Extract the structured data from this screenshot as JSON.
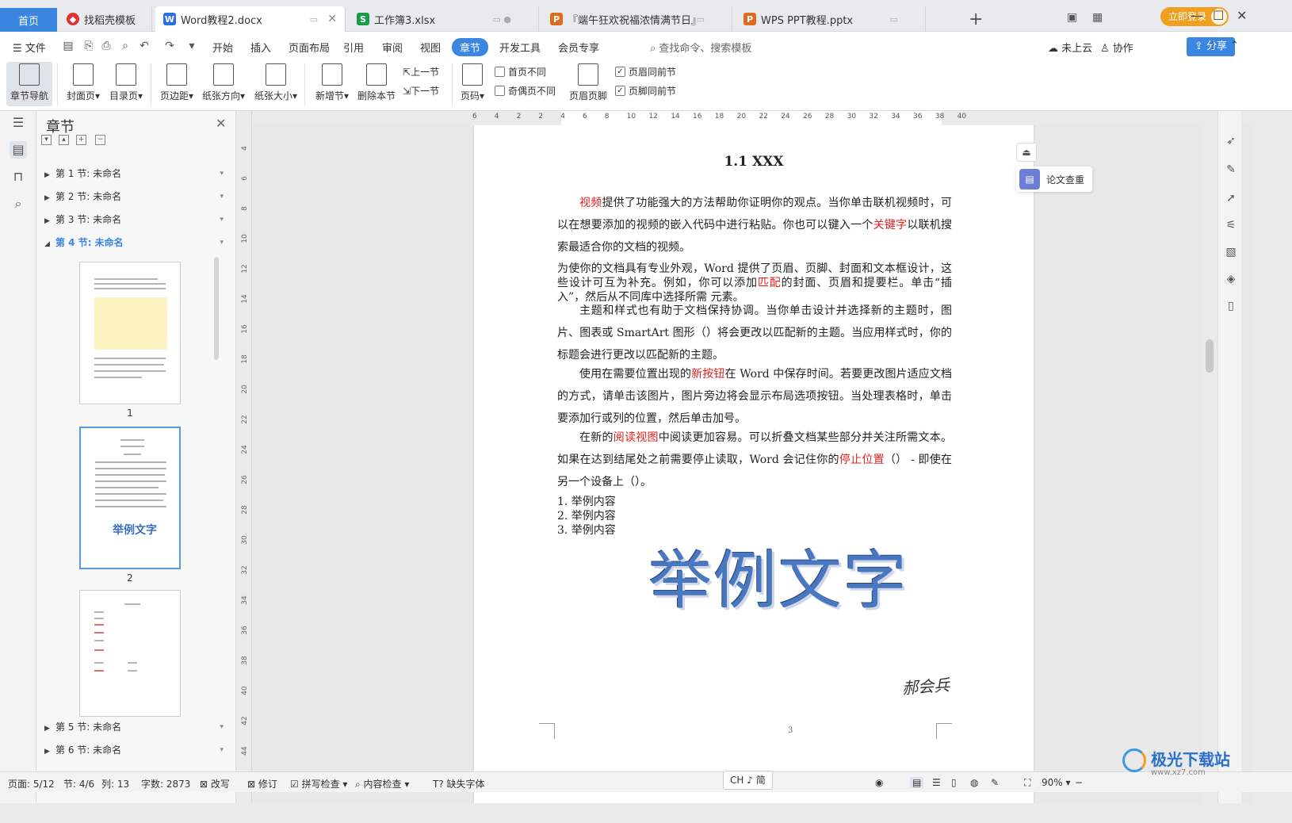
{
  "tabs": {
    "home": "首页",
    "items": [
      {
        "label": "找稻壳模板",
        "icon": "docer-icon",
        "color": "#e03030"
      },
      {
        "label": "Word教程2.docx",
        "icon": "wps-writer-icon",
        "color": "#2a70e0"
      },
      {
        "label": "工作簿3.xlsx",
        "icon": "wps-sheet-icon",
        "color": "#1a9a4a"
      },
      {
        "label": "『端午狂欢祝福浓情满节日』",
        "icon": "wps-ppt-icon",
        "color": "#e06a20"
      },
      {
        "label": "WPS PPT教程.pptx",
        "icon": "wps-ppt-icon",
        "color": "#e06a20"
      }
    ],
    "login": "立即登录"
  },
  "menu": {
    "file": "文件",
    "items": [
      "开始",
      "插入",
      "页面布局",
      "引用",
      "审阅",
      "视图",
      "章节",
      "开发工具",
      "会员专享"
    ],
    "active": "章节",
    "search": "查找命令、搜索模板",
    "cloud": "未上云",
    "collab": "协作",
    "share": "分享"
  },
  "ribbon": {
    "nav": "章节导航",
    "cover": "封面页",
    "toc": "目录页",
    "margin": "页边距",
    "orient": "纸张方向",
    "size": "纸张大小",
    "new_section": "新增节",
    "delete_section": "删除本节",
    "prev": "上一节",
    "next": "下一节",
    "page_num": "页码",
    "first_diff": "首页不同",
    "oddeven_diff": "奇偶页不同",
    "header_footer": "页眉页脚",
    "header_same": "页眉同前节",
    "footer_same": "页脚同前节"
  },
  "section_panel": {
    "title": "章节",
    "sections": [
      "第 1 节: 未命名",
      "第 2 节: 未命名",
      "第 3 节: 未命名",
      "第 4 节: 未命名",
      "第 5 节: 未命名",
      "第 6 节: 未命名"
    ],
    "thumbs": [
      "1",
      "2"
    ],
    "thumb_text": "举例文字"
  },
  "document": {
    "heading": "1.1 XXX",
    "p1": [
      {
        "t": "视频",
        "red": true
      },
      {
        "t": "提供了功能强大的方法帮助你证明你的观点。当你单击联机视频时，可以在想要添加的视频的嵌入代码中进行粘贴。你也可以键入一个"
      },
      {
        "t": "关键字",
        "red": true
      },
      {
        "t": "以联机搜索最适合你的文档的视频。"
      }
    ],
    "p2": [
      {
        "t": "为使你的文档具有专业外观，Word 提供了页眉、页脚、封面和文本框设计，这些设计可互为补充。例如，你可以添加"
      },
      {
        "t": "匹配",
        "red": true
      },
      {
        "t": "的封面、页眉和提要栏。单击“插入”，然后从不同库中选择所需 元素。"
      }
    ],
    "p3": [
      {
        "t": "主题和样式也有助于文档保持协调。当你单击设计并选择新的主题时，图片、图表或 SmartArt 图形（）将会更改以匹配新的主题。当应用样式时，你的标题会进行更改以匹配新的主题。"
      }
    ],
    "p4": [
      {
        "t": "使用在需要位置出现的"
      },
      {
        "t": "新按钮",
        "red": true
      },
      {
        "t": "在 Word 中保存时间。若要更改图片适应文档的方式，请单击该图片，图片旁边将会显示布局选项按钮。当处理表格时，单击要添加行或列的位置，然后单击加号。"
      }
    ],
    "p5": [
      {
        "t": "在新的"
      },
      {
        "t": "阅读视图",
        "red": true
      },
      {
        "t": "中阅读更加容易。可以折叠文档某些部分并关注所需文本。如果在达到结尾处之前需要停止读取，Word 会记住你的"
      },
      {
        "t": "停止位置",
        "red": true
      },
      {
        "t": "（） - 即使在另一个设备上（）。"
      }
    ],
    "list": [
      "1. 举例内容",
      "2. 举例内容",
      "3. 举例内容"
    ],
    "wordart": "举例文字",
    "signature": "郝会兵",
    "page_footer": "3"
  },
  "float": {
    "check": "论文查重"
  },
  "statusbar": {
    "page": "页面: 5/12",
    "section": "节: 4/6",
    "col": "列: 13",
    "words": "字数: 2873",
    "overwrite": "改写",
    "revise": "修订",
    "spell": "拼写检查",
    "content": "内容检查",
    "missing_font": "缺失字体",
    "ime": "CH ♪ 简",
    "zoom": "90%"
  },
  "watermark": {
    "name": "极光下载站",
    "url": "www.xz7.com"
  },
  "ruler": {
    "h": [
      "6",
      "4",
      "2",
      "2",
      "4",
      "6",
      "8",
      "10",
      "12",
      "14",
      "16",
      "18",
      "20",
      "22",
      "24",
      "26",
      "28",
      "30",
      "32",
      "34",
      "36",
      "38",
      "40"
    ],
    "v": [
      "4",
      "6",
      "8",
      "10",
      "12",
      "14",
      "16",
      "18",
      "20",
      "22",
      "24",
      "26",
      "28",
      "30",
      "32",
      "34",
      "36",
      "38",
      "40",
      "42",
      "44"
    ]
  }
}
